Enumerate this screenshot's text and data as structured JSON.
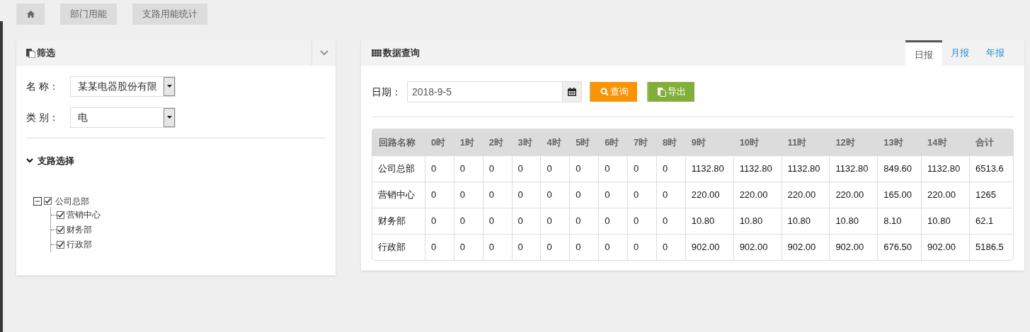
{
  "breadcrumb": [
    {
      "kind": "home"
    },
    {
      "kind": "text",
      "label": "部门用能"
    },
    {
      "kind": "text",
      "label": "支路用能统计"
    }
  ],
  "filter": {
    "title": "筛选",
    "fields": [
      {
        "label": "名 称：",
        "value": "某某电器股份有限"
      },
      {
        "label": "类 别：",
        "value": "电"
      }
    ],
    "branch_section": {
      "title": "支路选择",
      "expanded": true
    },
    "tree": [
      {
        "label": "公司总部",
        "checked": true,
        "expanded": true,
        "children": [
          {
            "label": "营销中心",
            "checked": true
          },
          {
            "label": "财务部",
            "checked": true
          },
          {
            "label": "行政部",
            "checked": true
          }
        ]
      }
    ]
  },
  "query": {
    "title": "数据查询",
    "tabs": [
      {
        "label": "日报",
        "selected": true
      },
      {
        "label": "月报",
        "selected": false
      },
      {
        "label": "年报",
        "selected": false
      }
    ],
    "date_label": "日期：",
    "date_value": "2018-9-5",
    "search_button": "查询",
    "export_button": "导出",
    "table": {
      "columns": [
        "回路名称",
        "0时",
        "1时",
        "2时",
        "3时",
        "4时",
        "5时",
        "6时",
        "7时",
        "8时",
        "9时",
        "10时",
        "11时",
        "12时",
        "13时",
        "14时",
        "合计"
      ],
      "rows": [
        [
          "公司总部",
          "0",
          "0",
          "0",
          "0",
          "0",
          "0",
          "0",
          "0",
          "0",
          "1132.80",
          "1132.80",
          "1132.80",
          "1132.80",
          "849.60",
          "1132.80",
          "6513.6"
        ],
        [
          "营销中心",
          "0",
          "0",
          "0",
          "0",
          "0",
          "0",
          "0",
          "0",
          "0",
          "220.00",
          "220.00",
          "220.00",
          "220.00",
          "165.00",
          "220.00",
          "1265"
        ],
        [
          "财务部",
          "0",
          "0",
          "0",
          "0",
          "0",
          "0",
          "0",
          "0",
          "0",
          "10.80",
          "10.80",
          "10.80",
          "10.80",
          "8.10",
          "10.80",
          "62.1"
        ],
        [
          "行政部",
          "0",
          "0",
          "0",
          "0",
          "0",
          "0",
          "0",
          "0",
          "0",
          "902.00",
          "902.00",
          "902.00",
          "902.00",
          "676.50",
          "902.00",
          "5186.5"
        ]
      ]
    }
  }
}
